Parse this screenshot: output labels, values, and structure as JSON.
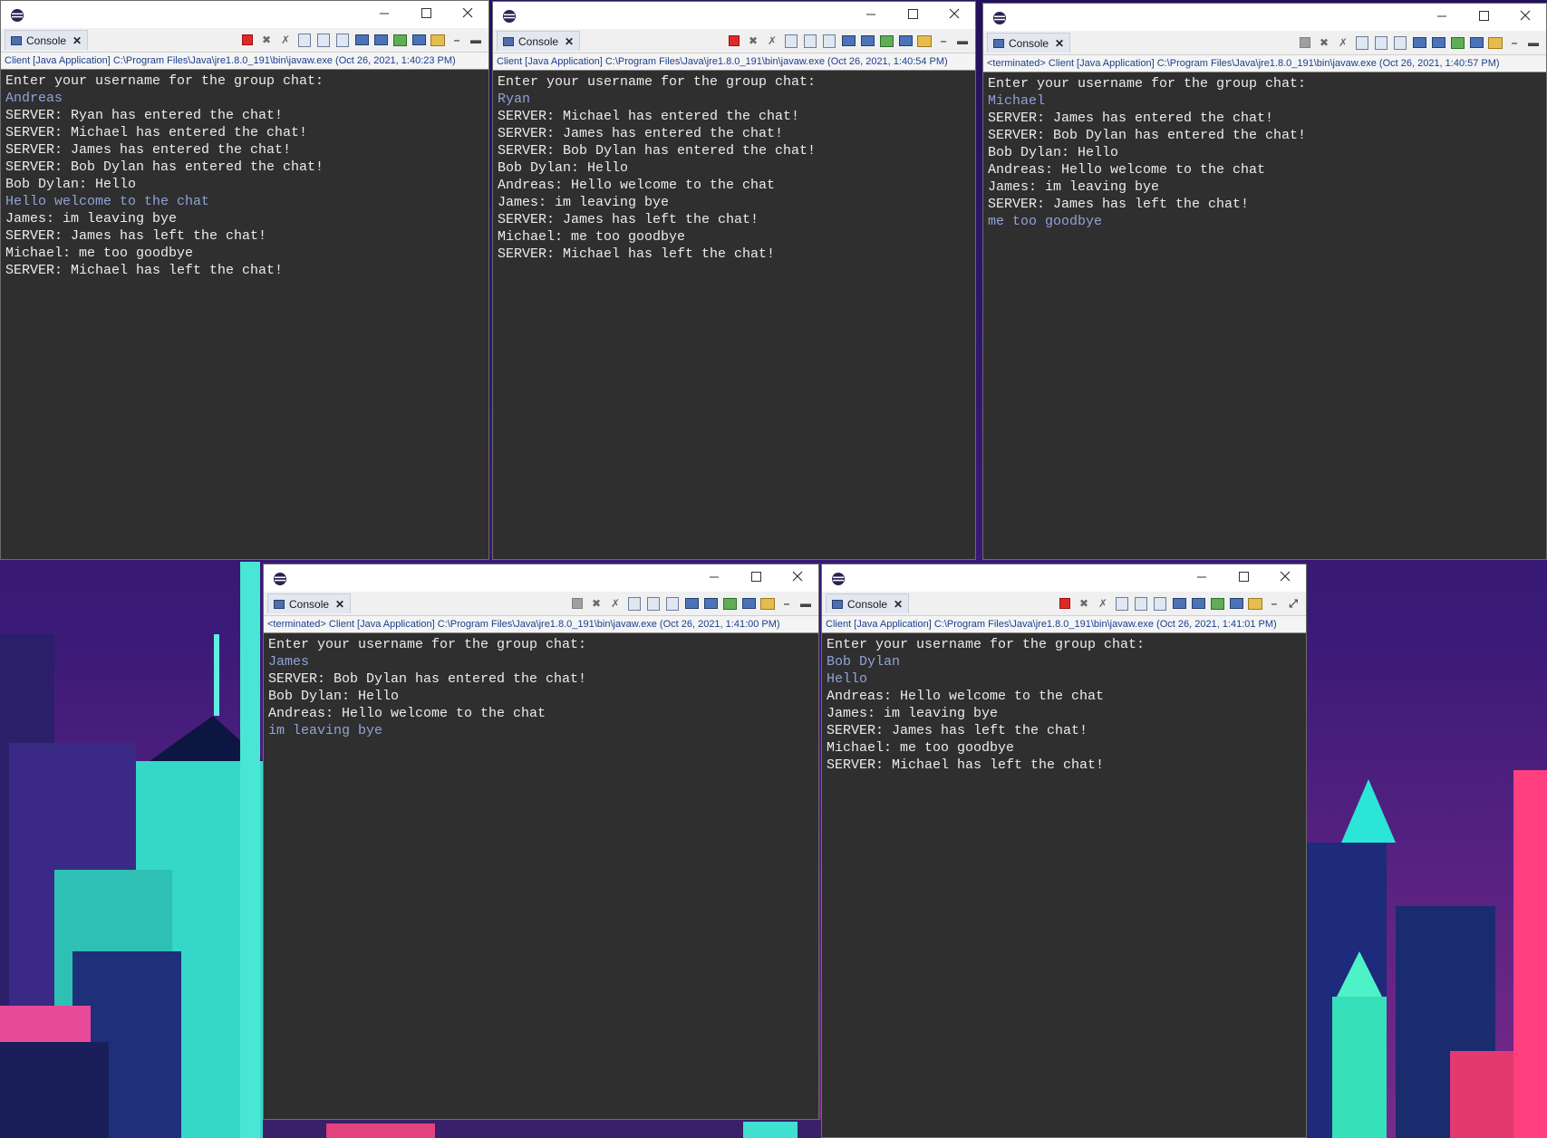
{
  "colors": {
    "console_bg": "#2f2f2f",
    "console_text": "#ececec",
    "user_input": "#8fa3d8",
    "status_link": "#1b3f8f",
    "stop_red": "#e02828"
  },
  "icons": {
    "app": "eclipse-icon",
    "minimize": "minimize-icon",
    "maximize": "maximize-icon",
    "close": "close-icon"
  },
  "windows": [
    {
      "tab_label": "Console",
      "terminated": false,
      "status": "Client [Java Application] C:\\Program Files\\Java\\jre1.8.0_191\\bin\\javaw.exe (Oct 26, 2021, 1:40:23 PM)",
      "lines": [
        {
          "t": "Enter your username for the group chat:",
          "k": "out"
        },
        {
          "t": "Andreas",
          "k": "in"
        },
        {
          "t": "SERVER: Ryan has entered the chat!",
          "k": "out"
        },
        {
          "t": "SERVER: Michael has entered the chat!",
          "k": "out"
        },
        {
          "t": "SERVER: James has entered the chat!",
          "k": "out"
        },
        {
          "t": "SERVER: Bob Dylan has entered the chat!",
          "k": "out"
        },
        {
          "t": "Bob Dylan: Hello",
          "k": "out"
        },
        {
          "t": "Hello welcome to the chat",
          "k": "in"
        },
        {
          "t": "James: im leaving bye",
          "k": "out"
        },
        {
          "t": "SERVER: James has left the chat!",
          "k": "out"
        },
        {
          "t": "Michael: me too goodbye",
          "k": "out"
        },
        {
          "t": "SERVER: Michael has left the chat!",
          "k": "out"
        }
      ]
    },
    {
      "tab_label": "Console",
      "terminated": false,
      "status": "Client [Java Application] C:\\Program Files\\Java\\jre1.8.0_191\\bin\\javaw.exe (Oct 26, 2021, 1:40:54 PM)",
      "lines": [
        {
          "t": "Enter your username for the group chat:",
          "k": "out"
        },
        {
          "t": "Ryan",
          "k": "in"
        },
        {
          "t": "SERVER: Michael has entered the chat!",
          "k": "out"
        },
        {
          "t": "SERVER: James has entered the chat!",
          "k": "out"
        },
        {
          "t": "SERVER: Bob Dylan has entered the chat!",
          "k": "out"
        },
        {
          "t": "Bob Dylan: Hello",
          "k": "out"
        },
        {
          "t": "Andreas: Hello welcome to the chat",
          "k": "out"
        },
        {
          "t": "James: im leaving bye",
          "k": "out"
        },
        {
          "t": "SERVER: James has left the chat!",
          "k": "out"
        },
        {
          "t": "Michael: me too goodbye",
          "k": "out"
        },
        {
          "t": "SERVER: Michael has left the chat!",
          "k": "out"
        }
      ]
    },
    {
      "tab_label": "Console",
      "terminated": true,
      "status": "<terminated> Client [Java Application] C:\\Program Files\\Java\\jre1.8.0_191\\bin\\javaw.exe (Oct 26, 2021, 1:40:57 PM)",
      "lines": [
        {
          "t": "Enter your username for the group chat:",
          "k": "out"
        },
        {
          "t": "Michael",
          "k": "in"
        },
        {
          "t": "SERVER: James has entered the chat!",
          "k": "out"
        },
        {
          "t": "SERVER: Bob Dylan has entered the chat!",
          "k": "out"
        },
        {
          "t": "Bob Dylan: Hello",
          "k": "out"
        },
        {
          "t": "Andreas: Hello welcome to the chat",
          "k": "out"
        },
        {
          "t": "James: im leaving bye",
          "k": "out"
        },
        {
          "t": "SERVER: James has left the chat!",
          "k": "out"
        },
        {
          "t": "me too goodbye",
          "k": "in"
        }
      ]
    },
    {
      "tab_label": "Console",
      "terminated": true,
      "status": "<terminated> Client [Java Application] C:\\Program Files\\Java\\jre1.8.0_191\\bin\\javaw.exe (Oct 26, 2021, 1:41:00 PM)",
      "lines": [
        {
          "t": "Enter your username for the group chat:",
          "k": "out"
        },
        {
          "t": "James",
          "k": "in"
        },
        {
          "t": "SERVER: Bob Dylan has entered the chat!",
          "k": "out"
        },
        {
          "t": "Bob Dylan: Hello",
          "k": "out"
        },
        {
          "t": "Andreas: Hello welcome to the chat",
          "k": "out"
        },
        {
          "t": "im leaving bye",
          "k": "in"
        }
      ]
    },
    {
      "tab_label": "Console",
      "terminated": false,
      "status": "Client [Java Application] C:\\Program Files\\Java\\jre1.8.0_191\\bin\\javaw.exe (Oct 26, 2021, 1:41:01 PM)",
      "lines": [
        {
          "t": "Enter your username for the group chat:",
          "k": "out"
        },
        {
          "t": "Bob Dylan",
          "k": "in"
        },
        {
          "t": "Hello",
          "k": "in"
        },
        {
          "t": "Andreas: Hello welcome to the chat",
          "k": "out"
        },
        {
          "t": "James: im leaving bye",
          "k": "out"
        },
        {
          "t": "SERVER: James has left the chat!",
          "k": "out"
        },
        {
          "t": "Michael: me too goodbye",
          "k": "out"
        },
        {
          "t": "SERVER: Michael has left the chat!",
          "k": "out"
        }
      ]
    }
  ]
}
